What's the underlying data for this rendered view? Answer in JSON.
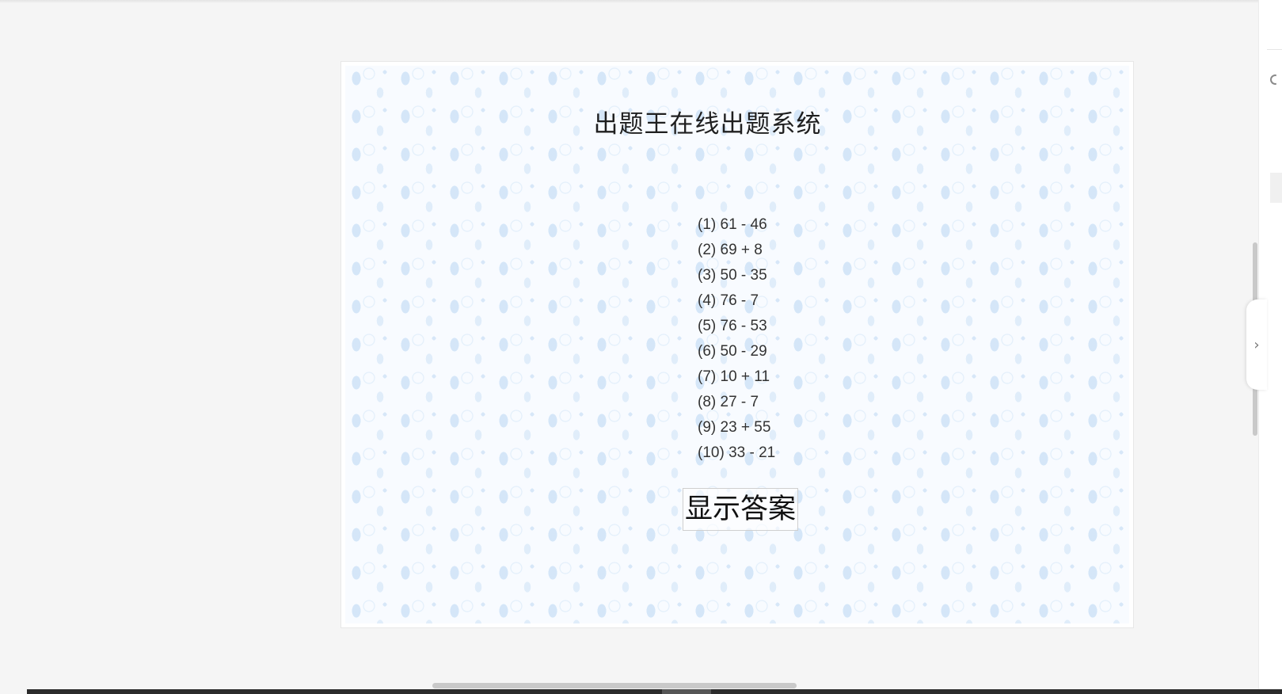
{
  "preview": {
    "title": "出题王在线出题系统",
    "questions": [
      "(1) 61 - 46",
      "(2) 69 + 8",
      "(3) 50 - 35",
      "(4) 76 - 7",
      "(5) 76 - 53",
      "(6) 50 - 29",
      "(7) 10 + 11",
      "(8) 27 - 7",
      "(9) 23 + 55",
      "(10) 33 - 21"
    ],
    "show_answer_label": "显示答案"
  },
  "side_toggle": {
    "icon": "chevron-right-icon",
    "glyph": "›"
  },
  "rail": {
    "search_icon": "search-icon"
  },
  "colors": {
    "page_background": "#f5f5f5",
    "pattern_tint": "#aacdf0",
    "text": "#1f1f1f"
  }
}
